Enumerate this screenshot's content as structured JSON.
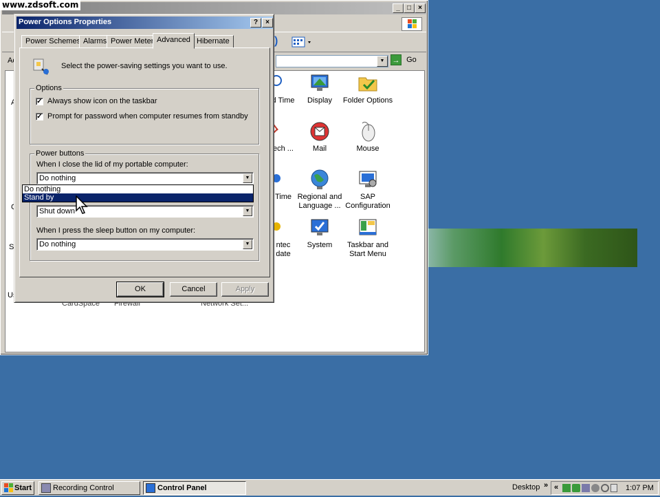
{
  "watermark": "www.zdsoft.com",
  "control_panel": {
    "title": "Control Panel",
    "address_label": "Ac",
    "go_label": "Go",
    "left_partial_labels": [
      "A",
      "C",
      "Sc",
      "Us"
    ],
    "items": [
      {
        "label": "d Time",
        "icon": "clock-icon"
      },
      {
        "label": "Display",
        "icon": "display-icon"
      },
      {
        "label": "Folder Options",
        "icon": "folder-options-icon"
      },
      {
        "label": "ech ...",
        "icon": "speech-icon"
      },
      {
        "label": "Mail",
        "icon": "mail-icon"
      },
      {
        "label": "Mouse",
        "icon": "mouse-icon"
      },
      {
        "label": "Time",
        "icon": "phone-icon"
      },
      {
        "label": "Regional and Language ...",
        "icon": "globe-icon"
      },
      {
        "label": "SAP Configuration",
        "icon": "sap-icon"
      },
      {
        "label": "ntec date",
        "icon": "update-icon"
      },
      {
        "label": "System",
        "icon": "system-icon"
      },
      {
        "label": "Taskbar and Start Menu",
        "icon": "taskbar-icon"
      }
    ],
    "bottom_partial_labels": [
      "CardSpace",
      "Firewall",
      "Network Set..."
    ]
  },
  "dialog": {
    "title": "Power Options Properties",
    "help_btn": "?",
    "close_btn": "×",
    "tabs": [
      "Power Schemes",
      "Alarms",
      "Power Meter",
      "Advanced",
      "Hibernate"
    ],
    "active_tab": "Advanced",
    "intro": "Select the power-saving settings you want to use.",
    "options_group": "Options",
    "options": [
      {
        "label": "Always show icon on the taskbar",
        "checked": true
      },
      {
        "label": "Prompt for password when computer resumes from standby",
        "checked": true
      }
    ],
    "power_buttons_group": "Power buttons",
    "lid_label": "When I close the lid of my portable computer:",
    "lid_value": "Do nothing",
    "lid_options": [
      "Do nothing",
      "Stand by"
    ],
    "lid_highlighted": "Stand by",
    "power_value": "Shut down",
    "sleep_label": "When I press the sleep button on my computer:",
    "sleep_value": "Do nothing",
    "ok": "OK",
    "cancel": "Cancel",
    "apply": "Apply"
  },
  "taskbar": {
    "start": "Start",
    "tasks": [
      "Recording Control",
      "Control Panel"
    ],
    "desktop": "Desktop",
    "chevron": "»",
    "tray_chevron": "«",
    "clock": "1:07 PM"
  }
}
